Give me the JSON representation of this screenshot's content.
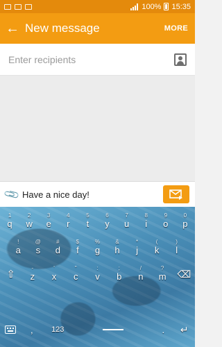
{
  "status_bar": {
    "battery": "100%",
    "time": "15:35"
  },
  "app_bar": {
    "back_icon": "arrow-left-icon",
    "title": "New message",
    "more": "MORE"
  },
  "recipients": {
    "placeholder": "Enter recipients",
    "contact_icon": "contact-picker-icon"
  },
  "composer": {
    "attach_icon": "paperclip-icon",
    "message": "Have a nice day!",
    "send_icon": "send-envelope-icon"
  },
  "keyboard": {
    "row1": [
      {
        "main": "q",
        "sub": "1"
      },
      {
        "main": "w",
        "sub": "2"
      },
      {
        "main": "e",
        "sub": "3"
      },
      {
        "main": "r",
        "sub": "4"
      },
      {
        "main": "t",
        "sub": "5"
      },
      {
        "main": "y",
        "sub": "6"
      },
      {
        "main": "u",
        "sub": "7"
      },
      {
        "main": "i",
        "sub": "8"
      },
      {
        "main": "o",
        "sub": "9"
      },
      {
        "main": "p",
        "sub": "0"
      }
    ],
    "row2": [
      {
        "main": "a",
        "sub": "!"
      },
      {
        "main": "s",
        "sub": "@"
      },
      {
        "main": "d",
        "sub": "#"
      },
      {
        "main": "f",
        "sub": "$"
      },
      {
        "main": "g",
        "sub": "%"
      },
      {
        "main": "h",
        "sub": "&"
      },
      {
        "main": "j",
        "sub": "*"
      },
      {
        "main": "k",
        "sub": "("
      },
      {
        "main": "l",
        "sub": ")"
      }
    ],
    "row3": [
      {
        "main": "z",
        "sub": "-"
      },
      {
        "main": "x",
        "sub": "'"
      },
      {
        "main": "c",
        "sub": "\""
      },
      {
        "main": "v",
        "sub": ":"
      },
      {
        "main": "b",
        "sub": ";"
      },
      {
        "main": "n",
        "sub": "/"
      },
      {
        "main": "m",
        "sub": "?"
      }
    ],
    "numbers_label": "123",
    "comma": ",",
    "period": "."
  },
  "colors": {
    "accent": "#f39c12",
    "status": "#e48a0c"
  }
}
